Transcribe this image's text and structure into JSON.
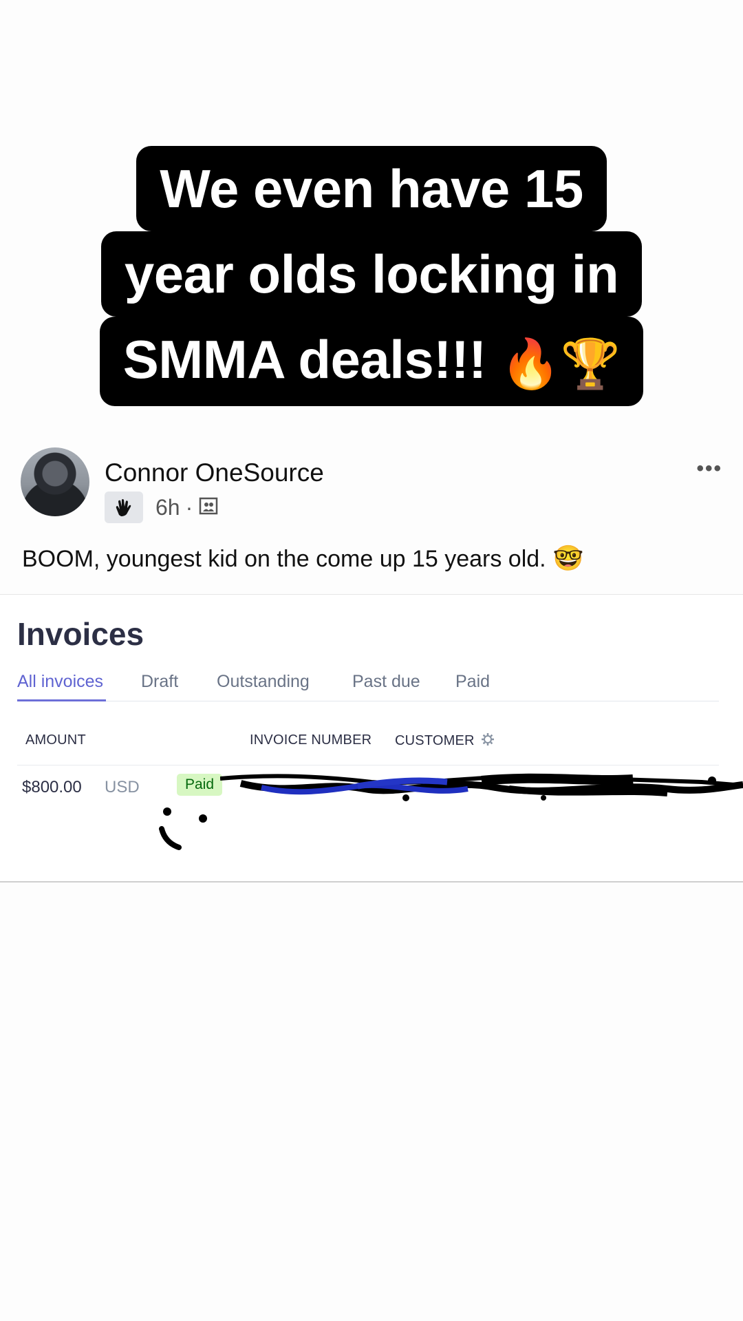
{
  "caption": {
    "line1": "We even have 15",
    "line2": "year olds locking in",
    "line3": "SMMA deals!!!",
    "emojis": "🔥🏆"
  },
  "post": {
    "author": "Connor OneSource",
    "time": "6h",
    "dot": "·",
    "text": "BOOM, youngest kid on the come up 15 years old.",
    "text_emoji": "🤓",
    "more": "•••",
    "badge_icon": "waving-hand-icon",
    "audience_icon": "group-audience-icon"
  },
  "invoices": {
    "title": "Invoices",
    "tabs": [
      "All invoices",
      "Draft",
      "Outstanding",
      "Past due",
      "Paid"
    ],
    "active_tab": "All invoices",
    "columns": {
      "amount": "AMOUNT",
      "invoice_number": "INVOICE NUMBER",
      "customer": "CUSTOMER"
    },
    "rows": [
      {
        "amount": "$800.00",
        "currency": "USD",
        "status": "Paid"
      }
    ],
    "colors": {
      "accent": "#5f63d1",
      "paid_bg": "#d7f7c2",
      "paid_text": "#05690d"
    }
  }
}
